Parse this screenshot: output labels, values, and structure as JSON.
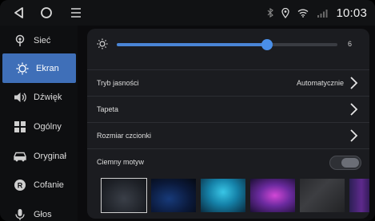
{
  "statusbar": {
    "time": "10:03",
    "icons": [
      "back-icon",
      "home-icon",
      "menu-icon",
      "bluetooth-icon",
      "location-icon",
      "wifi-icon",
      "signal-icon"
    ]
  },
  "sidebar": {
    "items": [
      {
        "label": "Sieć",
        "icon": "network-icon"
      },
      {
        "label": "Ekran",
        "icon": "brightness-icon",
        "active": true
      },
      {
        "label": "Dźwięk",
        "icon": "speaker-icon"
      },
      {
        "label": "Ogólny",
        "icon": "grid-icon"
      },
      {
        "label": "Oryginał",
        "icon": "car-icon"
      },
      {
        "label": "Cofanie",
        "icon": "reverse-icon"
      },
      {
        "label": "Głos",
        "icon": "microphone-icon"
      }
    ]
  },
  "display": {
    "brightness": {
      "value": "6",
      "level": 0.68
    },
    "brightness_mode": {
      "label": "Tryb jasności",
      "value": "Automatycznie"
    },
    "wallpaper": {
      "label": "Tapeta"
    },
    "font_size": {
      "label": "Rozmiar czcionki"
    },
    "dark_theme": {
      "label": "Ciemny motyw",
      "enabled": true
    },
    "wallpapers": [
      {
        "name": "dark-grey",
        "selected": true
      },
      {
        "name": "deep-blue"
      },
      {
        "name": "cyan-glow"
      },
      {
        "name": "purple-nebula"
      },
      {
        "name": "dark-texture"
      },
      {
        "name": "violet-edge"
      }
    ]
  },
  "colors": {
    "accent": "#3f6fb8",
    "slider": "#4a85d6"
  }
}
